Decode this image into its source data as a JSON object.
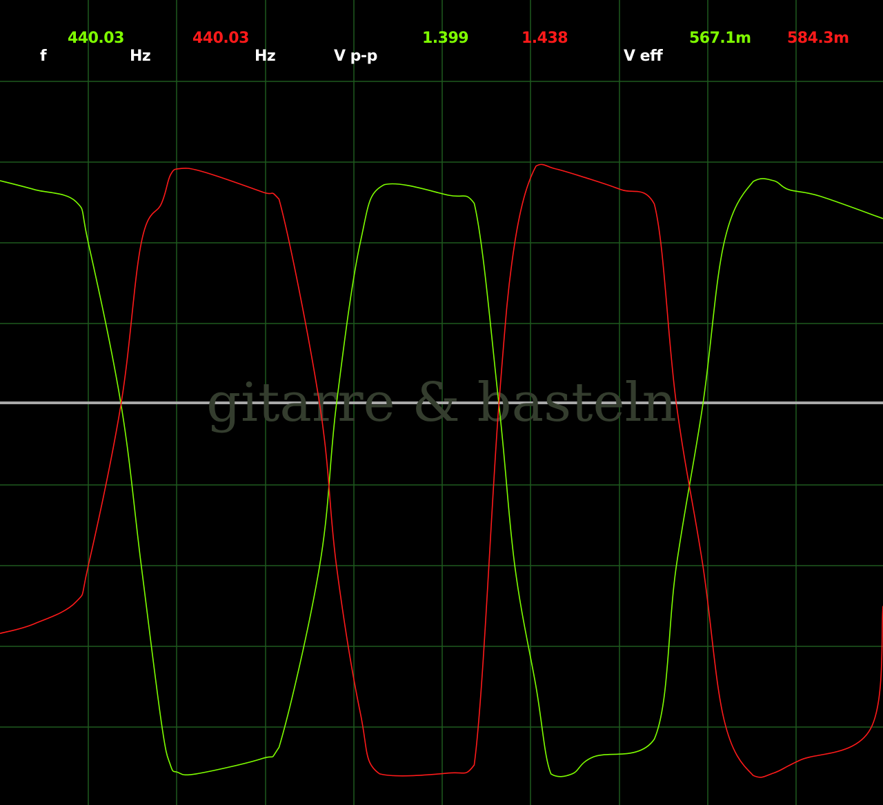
{
  "readouts": {
    "f_label": "f",
    "f_ch1": "440.03",
    "f_unit_ch1": "Hz",
    "f_ch2": "440.03",
    "f_unit_ch2": "Hz",
    "vpp_label": "V p-p",
    "vpp_ch1": "1.399",
    "vpp_ch2": "1.438",
    "veff_label": "V eff",
    "veff_ch1": "567.1m",
    "veff_ch2": "584.3m"
  },
  "watermark": "gitarre & basteln",
  "colors": {
    "background": "#000000",
    "grid": "#1f5a1f",
    "baseline": "#a9a9a9",
    "ch1": "#7fff00",
    "ch2": "#ff1a1a",
    "label": "#ffffff",
    "watermark": "#343d2e"
  },
  "chart_data": {
    "type": "line",
    "grid": true,
    "grid_divisions": {
      "x": 10,
      "y": 10
    },
    "xlim": [
      0,
      10
    ],
    "ylim": [
      -5,
      5
    ],
    "series": [
      {
        "name": "ch1",
        "color": "#7fff00",
        "x": [
          0,
          0.39,
          0.86,
          1.0,
          1.37,
          1.6,
          1.83,
          1.93,
          2.01,
          2.22,
          2.97,
          3.16,
          3.62,
          3.81,
          4.08,
          4.35,
          5.08,
          5.37,
          5.65,
          5.83,
          6.07,
          6.24,
          6.48,
          6.72,
          7.41,
          7.66,
          7.96,
          8.2,
          8.53,
          8.76,
          8.93,
          9.28,
          10.0
        ],
        "y": [
          2.77,
          2.66,
          2.51,
          2.0,
          0.0,
          -2.0,
          -3.96,
          -4.47,
          -4.56,
          -4.58,
          -4.39,
          -4.25,
          -2.0,
          0.0,
          2.0,
          2.72,
          2.59,
          2.49,
          0.0,
          -2.0,
          -3.5,
          -4.58,
          -4.58,
          -4.37,
          -4.15,
          -2.0,
          0.0,
          2.0,
          2.76,
          2.77,
          2.66,
          2.58,
          2.3
        ]
      },
      {
        "name": "ch2",
        "color": "#ff1a1a",
        "x": [
          0,
          0.39,
          0.86,
          1.0,
          1.37,
          1.6,
          1.83,
          1.93,
          2.04,
          2.3,
          2.97,
          3.16,
          3.62,
          3.81,
          4.08,
          4.3,
          5.08,
          5.37,
          5.65,
          5.83,
          6.07,
          6.28,
          6.62,
          7.03,
          7.41,
          7.66,
          7.96,
          8.2,
          8.53,
          8.76,
          9.06,
          9.86,
          10.0
        ],
        "y": [
          -2.84,
          -2.72,
          -2.45,
          -2.0,
          0.0,
          2.0,
          2.49,
          2.84,
          2.92,
          2.88,
          2.63,
          2.54,
          0.0,
          -2.0,
          -3.82,
          -4.58,
          -4.57,
          -4.47,
          0.0,
          2.0,
          2.95,
          2.92,
          2.81,
          2.66,
          2.48,
          0.0,
          -2.0,
          -3.91,
          -4.6,
          -4.57,
          -4.41,
          -4.02,
          -2.5
        ]
      }
    ]
  }
}
